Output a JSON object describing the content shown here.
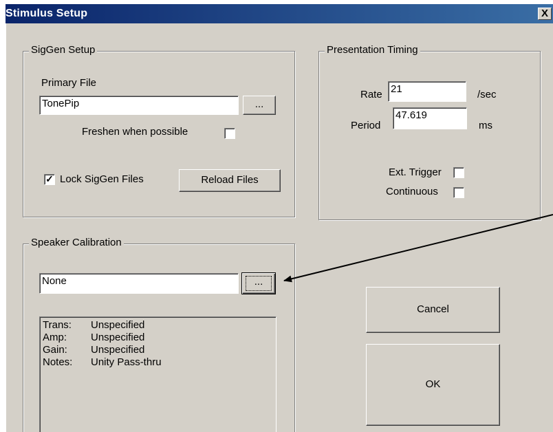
{
  "window": {
    "title": "Stimulus Setup",
    "close_glyph": "X"
  },
  "siggen": {
    "group_label": "SigGen Setup",
    "primary_file_label": "Primary File",
    "primary_file_value": "TonePip",
    "browse_label": "...",
    "freshen_label": "Freshen when possible",
    "freshen_checked": false,
    "lock_label": "Lock SigGen Files",
    "lock_checked": true,
    "lock_check_glyph": "✓",
    "reload_label": "Reload Files"
  },
  "timing": {
    "group_label": "Presentation Timing",
    "rate_label": "Rate",
    "rate_value": "21",
    "rate_unit": "/sec",
    "period_label": "Period",
    "period_value": "47.619",
    "period_unit": "ms",
    "ext_trigger_label": "Ext. Trigger",
    "ext_trigger_checked": false,
    "continuous_label": "Continuous",
    "continuous_checked": false
  },
  "speaker": {
    "group_label": "Speaker Calibration",
    "file_value": "None",
    "browse_label": "...",
    "info": [
      {
        "key": "Trans:",
        "value": "Unspecified"
      },
      {
        "key": "Amp:",
        "value": "Unspecified"
      },
      {
        "key": "Gain:",
        "value": "Unspecified"
      },
      {
        "key": "Notes:",
        "value": "Unity Pass-thru"
      }
    ]
  },
  "actions": {
    "cancel_label": "Cancel",
    "ok_label": "OK"
  },
  "annotation": {
    "arrow_color": "#000000"
  }
}
